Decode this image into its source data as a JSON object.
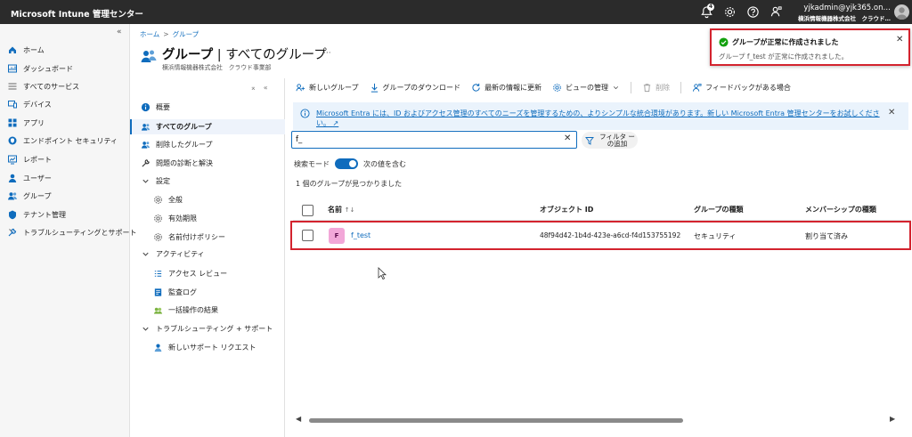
{
  "topbar": {
    "title": "Microsoft Intune 管理センター",
    "notification_count": "4",
    "account_name": "yjkadmin@yjk365.on…",
    "account_tenant": "横浜情報機器株式会社　クラウド…"
  },
  "leftnav": {
    "collapse": "«",
    "items": [
      {
        "label": "ホーム",
        "icon": "home-icon"
      },
      {
        "label": "ダッシュボード",
        "icon": "dashboard-icon"
      },
      {
        "label": "すべてのサービス",
        "icon": "all-services-icon"
      },
      {
        "label": "デバイス",
        "icon": "devices-icon"
      },
      {
        "label": "アプリ",
        "icon": "apps-icon"
      },
      {
        "label": "エンドポイント セキュリティ",
        "icon": "endpoint-security-icon"
      },
      {
        "label": "レポート",
        "icon": "reports-icon"
      },
      {
        "label": "ユーザー",
        "icon": "users-icon"
      },
      {
        "label": "グループ",
        "icon": "groups-icon"
      },
      {
        "label": "テナント管理",
        "icon": "tenant-admin-icon"
      },
      {
        "label": "トラブルシューティングとサポート",
        "icon": "troubleshoot-icon"
      }
    ]
  },
  "breadcrumb": {
    "home": "ホーム",
    "sep": ">",
    "current": "グループ"
  },
  "page": {
    "title": "グループ",
    "title_sep": " | ",
    "title_sub": "すべてのグループ",
    "more": "···",
    "subtitle": "横浜情報機器株式会社　クラウド事業部"
  },
  "resmenu": {
    "controls": "⌅«",
    "items": [
      {
        "label": "概要"
      },
      {
        "label": "すべてのグループ"
      },
      {
        "label": "削除したグループ"
      },
      {
        "label": "問題の診断と解決"
      },
      {
        "label": "設定"
      },
      {
        "label": "全般"
      },
      {
        "label": "有効期限"
      },
      {
        "label": "名前付けポリシー"
      },
      {
        "label": "アクティビティ"
      },
      {
        "label": "アクセス レビュー"
      },
      {
        "label": "監査ログ"
      },
      {
        "label": "一括操作の結果"
      },
      {
        "label": "トラブルシューティング + サポート"
      },
      {
        "label": "新しいサポート リクエスト"
      }
    ]
  },
  "toolbar": {
    "new_group": "新しいグループ",
    "download": "グループのダウンロード",
    "refresh": "最新の情報に更新",
    "manage_view": "ビューの管理",
    "delete": "削除",
    "feedback": "フィードバックがある場合"
  },
  "banner": {
    "text": "Microsoft Entra には、ID およびアクセス管理のすべてのニーズを管理するための、よりシンプルな統合環境があります。新しい Microsoft Entra 管理センターをお試しください。",
    "arrow": "↗"
  },
  "search": {
    "value": "f_",
    "placeholder": ""
  },
  "filter": {
    "label": "フィルタ ーの追加"
  },
  "search_mode": {
    "label": "検索モード",
    "option": "次の値を含む",
    "enabled": true
  },
  "result_count": "1 個のグループが見つかりました",
  "table": {
    "columns": [
      "名前",
      "オブジェクト ID",
      "グループの種類",
      "メンバーシップの種類"
    ],
    "sort_glyph": "↑↓",
    "rows": [
      {
        "avatar": "F",
        "name": "f_test",
        "object_id": "48f94d42-1b4d-423e-a6cd-f4d153755192",
        "group_type": "セキュリティ",
        "membership_type": "割り当て済み"
      }
    ]
  },
  "scroll": {
    "left": "◀",
    "right": "▶"
  },
  "toast": {
    "title": "グループが正常に作成されました",
    "body": "グループ f_test が正常に作成されました。"
  },
  "colors": {
    "accent": "#0f6cbd",
    "highlight": "#d3232e",
    "topbar": "#2b2b2b",
    "success": "#13a10e"
  }
}
